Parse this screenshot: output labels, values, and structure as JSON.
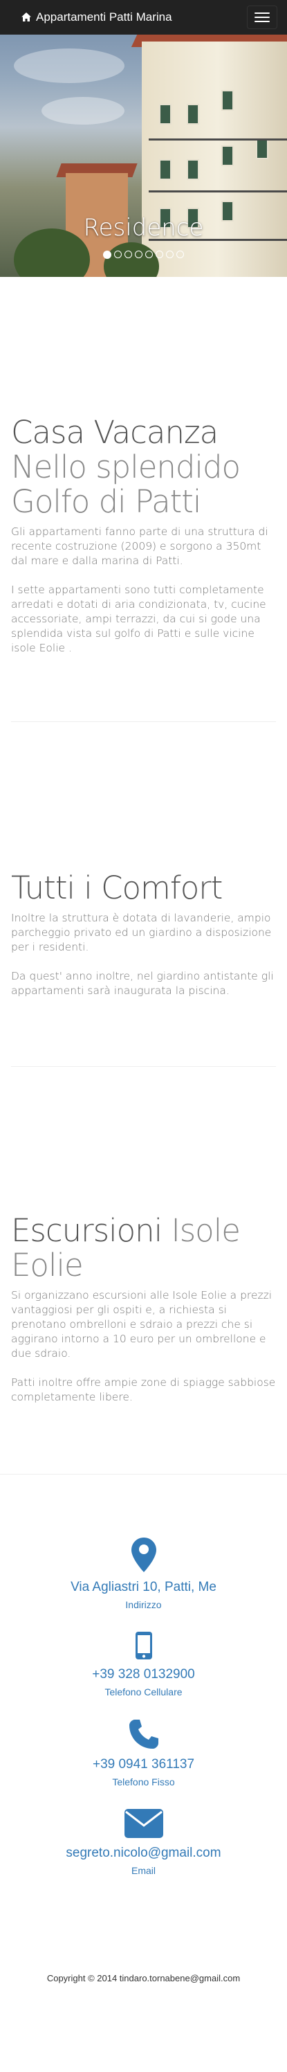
{
  "navbar": {
    "brand": "Appartamenti Patti Marina",
    "home_icon": "home-icon",
    "menu_icon": "hamburger-icon"
  },
  "carousel": {
    "caption": "Residence",
    "slide_count": 8,
    "active_index": 0
  },
  "sections": [
    {
      "heading": "Casa Vacanza",
      "subheading": "Nello splendido Golfo di Patti",
      "paragraphs": [
        "Gli appartamenti fanno parte di una struttura di recente costruzione (2009) e sorgono a 350mt dal mare e dalla marina di Patti.",
        "I sette appartamenti sono tutti completamente arredati e dotati di aria condizionata, tv, cucine accessoriate, ampi terrazzi, da cui si gode una splendida vista sul golfo di Patti e sulle vicine isole Eolie ."
      ]
    },
    {
      "heading": "Tutti i Comfort",
      "subheading": "",
      "paragraphs": [
        "Inoltre la struttura è dotata di lavanderie, ampio parcheggio privato ed un giardino a disposizione per i residenti.",
        "Da quest' anno inoltre, nel giardino antistante gli appartamenti sarà inaugurata la piscina."
      ]
    },
    {
      "heading": "Escursioni",
      "subheading": "Isole Eolie",
      "paragraphs": [
        "Si organizzano escursioni alle Isole Eolie a prezzi vantaggiosi per gli ospiti e, a richiesta si prenotano ombrelloni e sdraio a prezzi che si aggirano intorno a 10 euro per un ombrellone e due sdraio.",
        "Patti inoltre offre ampie zone di spiagge sabbiose completamente libere."
      ]
    }
  ],
  "contacts": [
    {
      "icon": "map-marker-icon",
      "value": "Via Agliastri 10, Patti, Me",
      "label": "Indirizzo"
    },
    {
      "icon": "mobile-phone-icon",
      "value": "+39 328 0132900",
      "label": "Telefono Cellulare"
    },
    {
      "icon": "phone-icon",
      "value": "+39 0941 361137",
      "label": "Telefono Fisso"
    },
    {
      "icon": "envelope-icon",
      "value": "segreto.nicolo@gmail.com",
      "label": "Email"
    }
  ],
  "footer": {
    "copyright": "Copyright © 2014 tindaro.tornabene@gmail.com"
  },
  "colors": {
    "navbar": "#222222",
    "link": "#337ab7",
    "heading": "#555555",
    "muted": "#888888"
  }
}
